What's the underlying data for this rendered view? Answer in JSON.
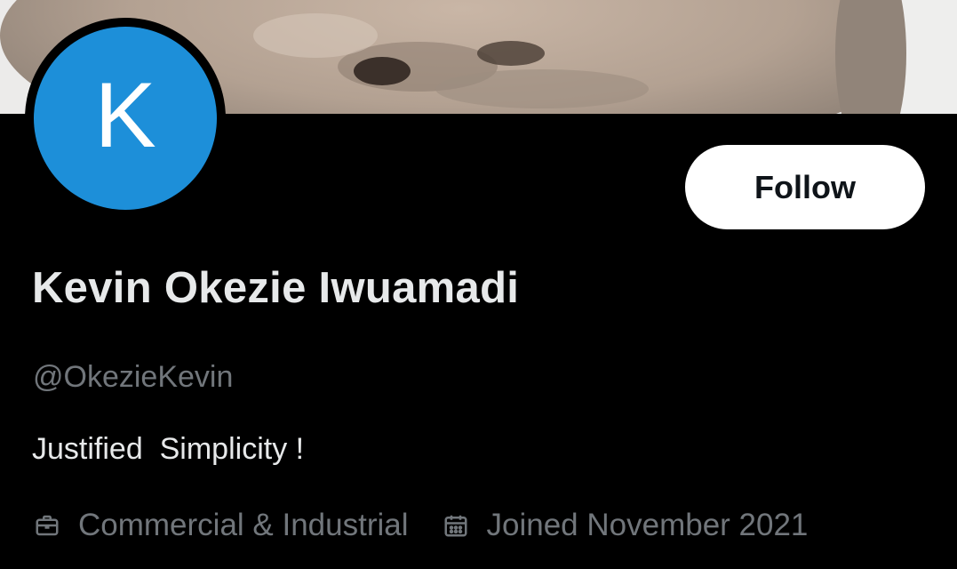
{
  "banner": {
    "description_icon": "profile-banner-photo"
  },
  "avatar": {
    "initial": "K",
    "color": "#1d8fd9"
  },
  "follow_button": {
    "label": "Follow"
  },
  "profile": {
    "display_name": "Kevin Okezie Iwuamadi",
    "handle": "@OkezieKevin",
    "bio": "Justified  Simplicity !"
  },
  "meta": {
    "category": {
      "icon": "briefcase-icon",
      "label": "Commercial & Industrial"
    },
    "joined": {
      "icon": "calendar-icon",
      "label": "Joined November 2021"
    }
  },
  "colors": {
    "background": "#000000",
    "primary_text": "#e7e9ea",
    "secondary_text": "#71767b",
    "button_bg": "#ffffff"
  }
}
